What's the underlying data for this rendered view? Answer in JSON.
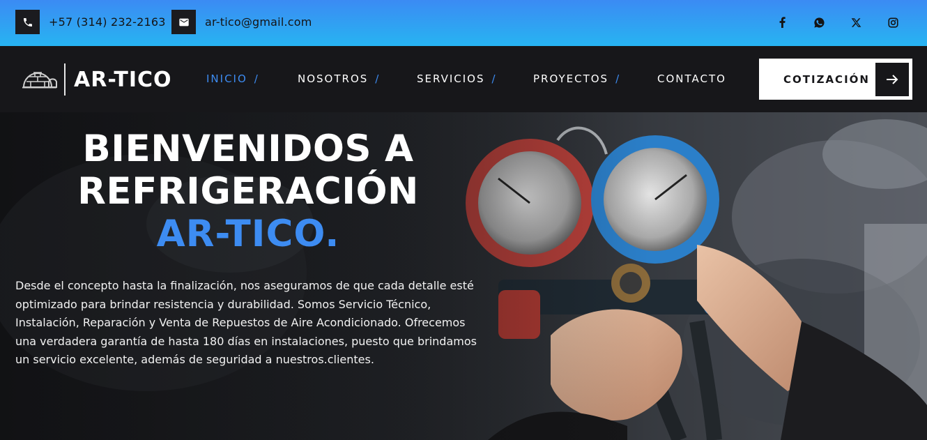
{
  "topbar": {
    "phone": {
      "icon": "phone-icon",
      "text": "+57 (314) 232-2163"
    },
    "email": {
      "icon": "mail-icon",
      "text": "ar-tico@gmail.com"
    },
    "socials": [
      "facebook-icon",
      "whatsapp-icon",
      "x-icon",
      "instagram-icon"
    ]
  },
  "navbar": {
    "logo_text": "AR-TICO",
    "logo_icon": "igloo-icon",
    "items": [
      {
        "label": "INICIO",
        "slash": "/",
        "active": true
      },
      {
        "label": "NOSOTROS",
        "slash": "/"
      },
      {
        "label": "SERVICIOS",
        "slash": "/"
      },
      {
        "label": "PROYECTOS",
        "slash": "/"
      },
      {
        "label": "CONTACTO",
        "slash": ""
      }
    ],
    "cta_label": "COTIZACIÓN",
    "cta_icon": "arrow-right-icon"
  },
  "hero": {
    "title_line1": "BIENVENIDOS A",
    "title_line2": "REFRIGERACIÓN",
    "title_brand": "AR-TICO.",
    "description": "Desde el concepto hasta la finalización, nos aseguramos de que cada detalle esté optimizado para brindar resistencia y durabilidad. Somos Servicio Técnico, Instalación, Reparación y Venta de Repuestos de Aire Acondicionado. Ofrecemos una verdadera garantía de hasta 180 días en instalaciones, puesto que brindamos un servicio excelente, además de seguridad a nuestros.clientes."
  },
  "colors": {
    "accent": "#3d8cf2",
    "topbar_start": "#3b8bf3",
    "topbar_end": "#27b4f2",
    "navbar_bg": "#17171a",
    "gauge_red": "#c8453d",
    "gauge_blue": "#2b7fc9"
  }
}
